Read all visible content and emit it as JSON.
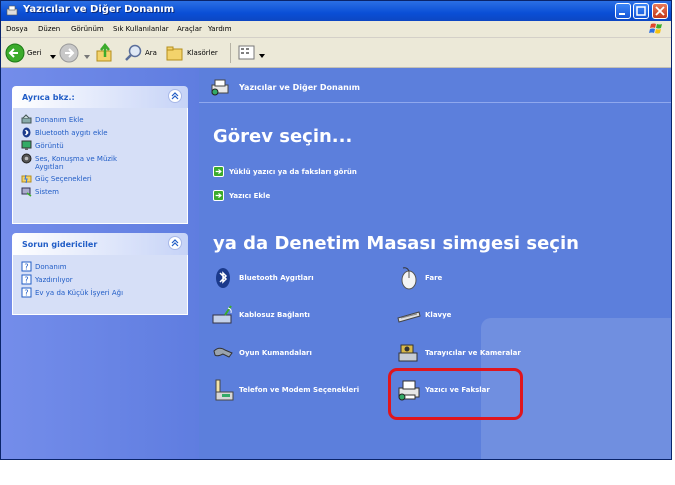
{
  "window": {
    "title": "Yazıcılar ve Diğer Donanım"
  },
  "menu": [
    "Dosya",
    "Düzen",
    "Görünüm",
    "Sık Kullanılanlar",
    "Araçlar",
    "Yardım"
  ],
  "toolbar": {
    "back_label": "Geri",
    "search_label": "Ara",
    "folders_label": "Klasörler"
  },
  "sidebar": {
    "see_also": {
      "title": "Ayrıca bkz.:",
      "items": [
        "Donanım Ekle",
        "Bluetooth aygıtı ekle",
        "Görüntü",
        "Ses, Konuşma ve Müzik Aygıtları",
        "Güç Seçenekleri",
        "Sistem"
      ]
    },
    "troubleshooters": {
      "title": "Sorun gidericiler",
      "items": [
        "Donanım",
        "Yazdırılıyor",
        "Ev ya da Küçük İşyeri Ağı"
      ]
    }
  },
  "main": {
    "header": "Yazıcılar ve Diğer Donanım",
    "pick_task_title": "Görev seçin...",
    "tasks": [
      "Yüklü yazıcı ya da faksları görün",
      "Yazıcı Ekle"
    ],
    "pick_icon_title": "ya da Denetim Masası simgesi seçin",
    "categories": [
      {
        "label": "Bluetooth Aygıtları",
        "icon": "bluetooth-icon"
      },
      {
        "label": "Fare",
        "icon": "mouse-icon"
      },
      {
        "label": "Kablosuz Bağlantı",
        "icon": "wireless-icon"
      },
      {
        "label": "Klavye",
        "icon": "keyboard-icon"
      },
      {
        "label": "Oyun Kumandaları",
        "icon": "gamepad-icon"
      },
      {
        "label": "Tarayıcılar ve Kameralar",
        "icon": "scanner-camera-icon"
      },
      {
        "label": "Telefon ve Modem Seçenekleri",
        "icon": "phone-modem-icon"
      },
      {
        "label": "Yazıcı ve Fakslar",
        "icon": "printer-fax-icon"
      }
    ]
  },
  "colors": {
    "titlebar": "#0a4fd6",
    "content_bg": "#5c7fdc",
    "highlight": "#e0151d"
  }
}
